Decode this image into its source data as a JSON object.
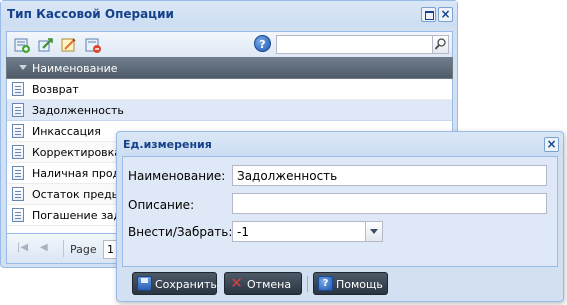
{
  "main_window": {
    "title": "Тип Кассовой Операции",
    "grid": {
      "column_header": "Наименование",
      "rows": [
        "Возврат",
        "Задолженность",
        "Инкассация",
        "Корректировка",
        "Наличная продаж",
        "Остаток предыд",
        "Погашение задол"
      ],
      "selected_index": 1
    },
    "search": {
      "value": ""
    },
    "pager": {
      "page_label": "Page",
      "page_value": "1"
    }
  },
  "dialog": {
    "title": "Ед.измерения",
    "fields": {
      "name_label": "Наименование:",
      "name_value": "Задолженность",
      "description_label": "Описание:",
      "description_value": "",
      "in_out_label": "Внести/Забрать:",
      "in_out_value": "-1"
    },
    "buttons": {
      "save": "Сохранить",
      "cancel": "Отмена",
      "help": "Помощь"
    }
  },
  "icons": {
    "add": "add-record-icon",
    "edit": "edit-record-icon",
    "export": "export-icon",
    "delete": "delete-record-icon",
    "help": "help-icon",
    "search": "search-icon",
    "document": "document-icon"
  },
  "colors": {
    "title_text": "#15428b",
    "window_border": "#99bbe8",
    "selected_row": "#dfe8f6",
    "grid_header": "#5a6775",
    "dark_button": "#2b3542"
  }
}
